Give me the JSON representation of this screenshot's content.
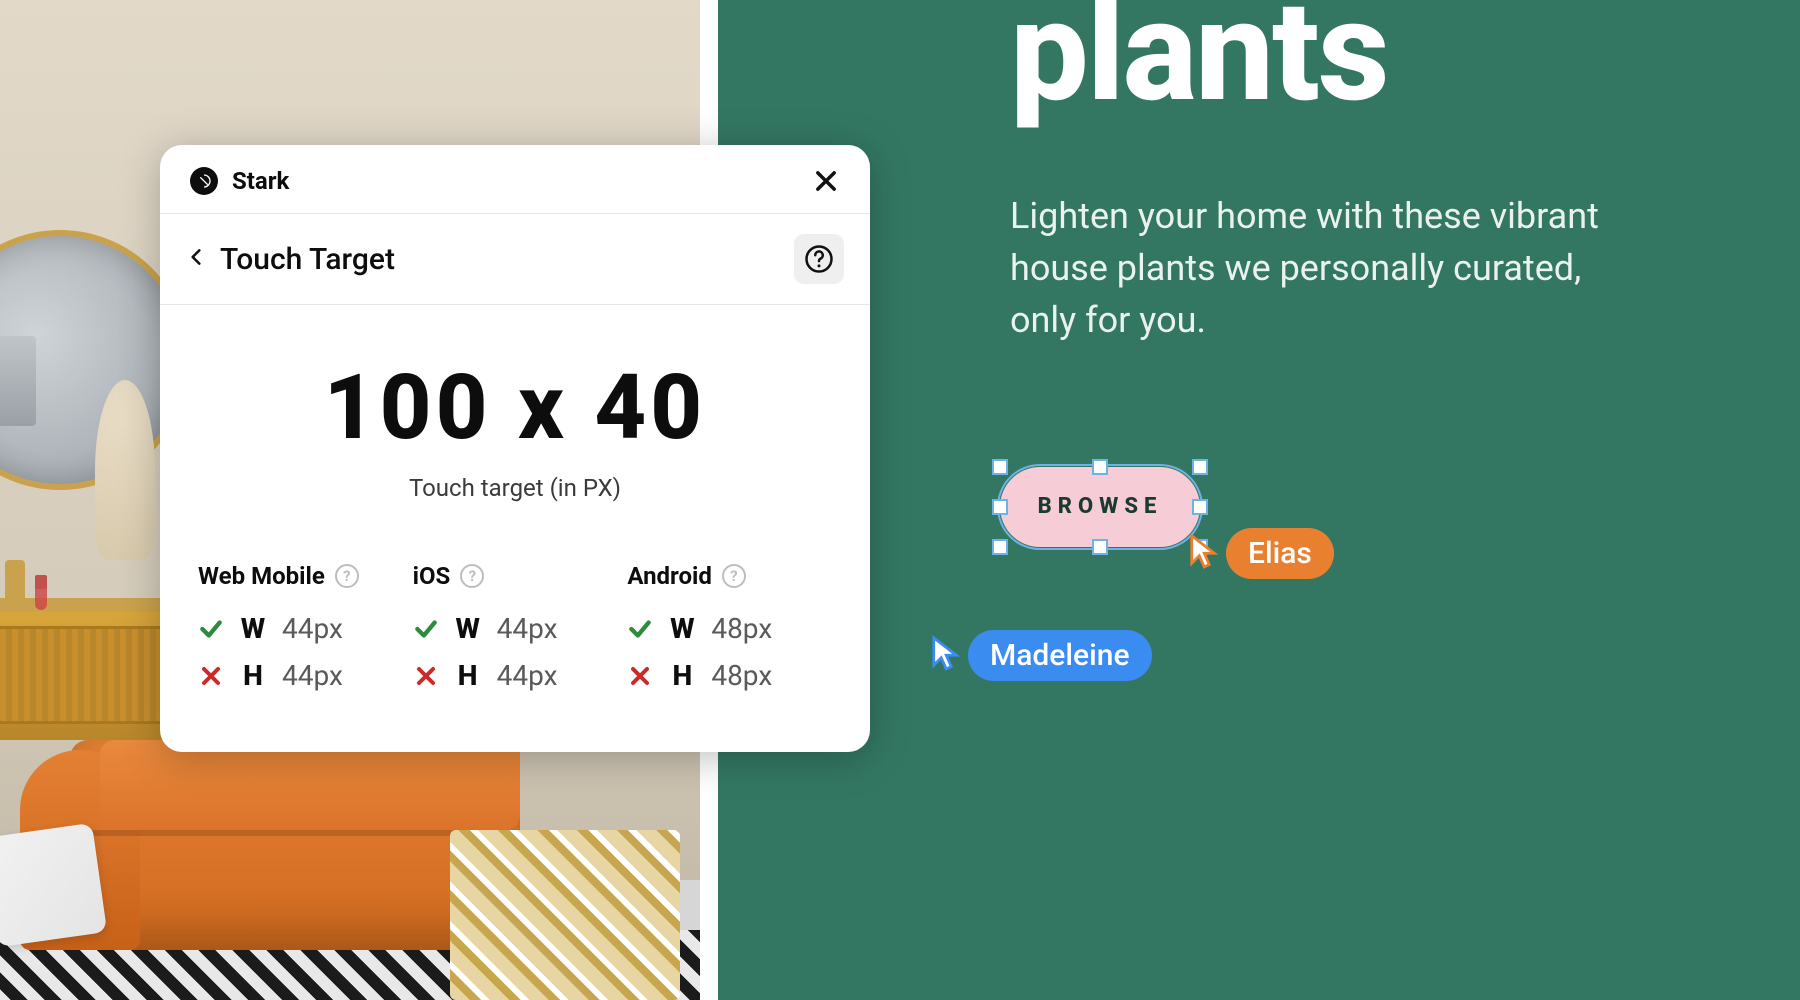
{
  "hero": {
    "title": "plants",
    "description": "Lighten your home with these vibrant house plants we personally curated, only for you.",
    "browse_label": "BROWSE"
  },
  "cursors": {
    "elias": "Elias",
    "madeleine": "Madeleine"
  },
  "dialog": {
    "brand": "Stark",
    "crumb": "Touch Target",
    "metric_value": "100 x 40",
    "metric_caption": "Touch target (in PX)",
    "platforms": [
      {
        "name": "Web Mobile",
        "w_pass": true,
        "w_val": "44px",
        "h_pass": false,
        "h_val": "44px"
      },
      {
        "name": "iOS",
        "w_pass": true,
        "w_val": "44px",
        "h_pass": false,
        "h_val": "44px"
      },
      {
        "name": "Android",
        "w_pass": true,
        "w_val": "48px",
        "h_pass": false,
        "h_val": "48px"
      }
    ],
    "w_label": "W",
    "h_label": "H"
  },
  "colors": {
    "green": "#337762",
    "pink": "#f6cdd6",
    "orange": "#e98030",
    "blue": "#3a8cf0"
  }
}
